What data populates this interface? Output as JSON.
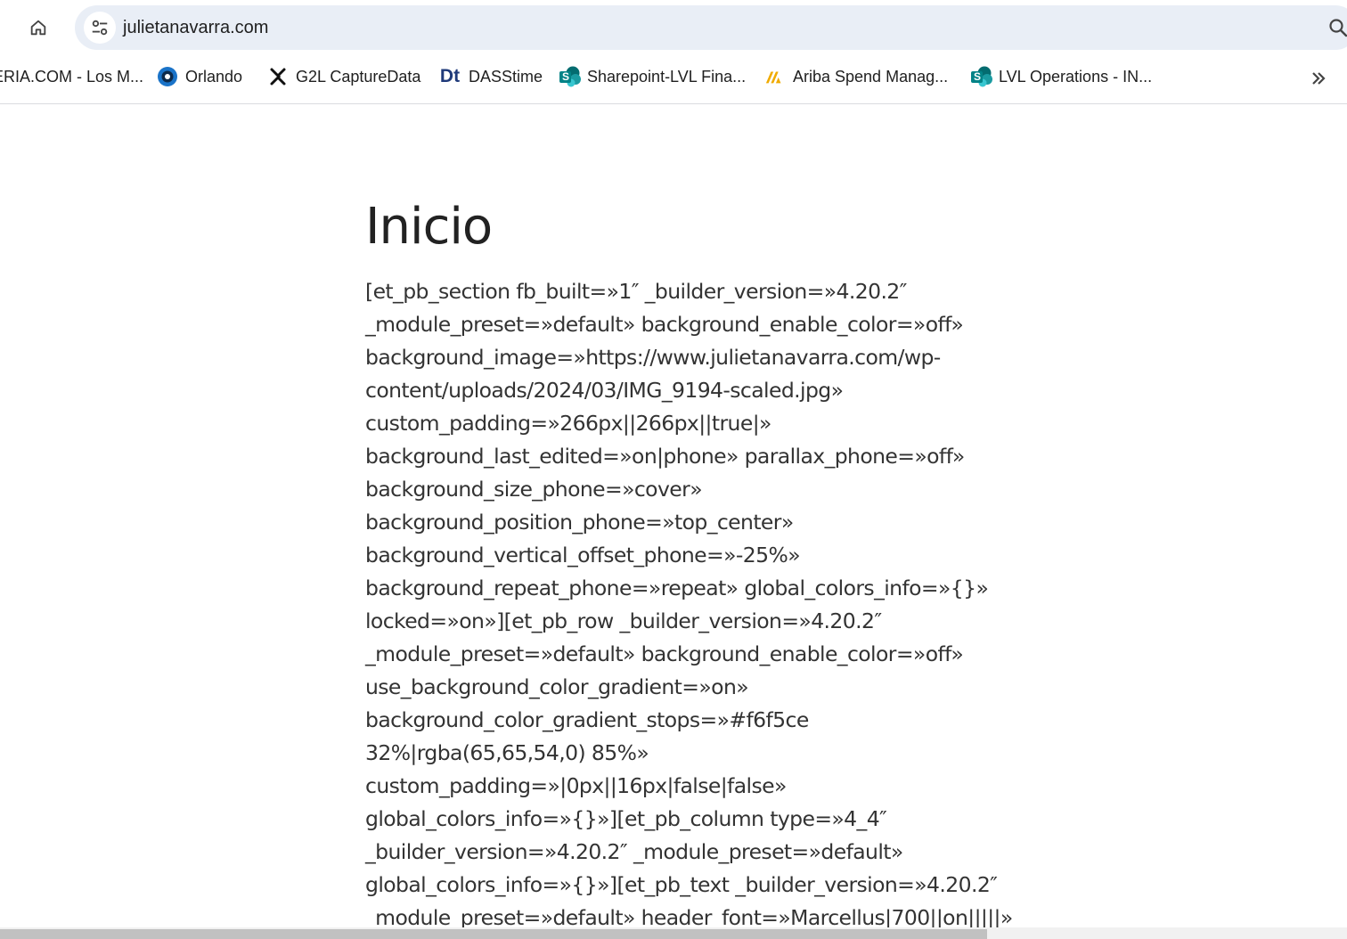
{
  "browser": {
    "url": "julietanavarra.com"
  },
  "bookmarks": [
    {
      "label": "ERIA.COM - Los M...",
      "icon": "none"
    },
    {
      "label": "Orlando",
      "icon": "circle-logo-icon"
    },
    {
      "label": "G2L CaptureData",
      "icon": "g2l-logo-icon"
    },
    {
      "label": "DASStime",
      "icon": "dt-logo-icon",
      "icon_text": "Dt"
    },
    {
      "label": "Sharepoint-LVL Fina...",
      "icon": "sharepoint-icon",
      "icon_text": "S"
    },
    {
      "label": "Ariba Spend Manag...",
      "icon": "ariba-logo-icon"
    },
    {
      "label": "LVL Operations - IN...",
      "icon": "sharepoint-icon",
      "icon_text": "S"
    }
  ],
  "page": {
    "title": "Inicio",
    "lines": [
      "[et_pb_section fb_built=»1″ _builder_version=»4.20.2″",
      "_module_preset=»default» background_enable_color=»off»",
      "background_image=»https://www.julietanavarra.com/wp-",
      "content/uploads/2024/03/IMG_9194-scaled.jpg»",
      "custom_padding=»266px||266px||true|»",
      "background_last_edited=»on|phone» parallax_phone=»off»",
      "background_size_phone=»cover»",
      "background_position_phone=»top_center»",
      "background_vertical_offset_phone=»-25%»",
      "background_repeat_phone=»repeat» global_colors_info=»{}»",
      "locked=»on»][et_pb_row _builder_version=»4.20.2″",
      "_module_preset=»default» background_enable_color=»off»",
      "use_background_color_gradient=»on»",
      "background_color_gradient_stops=»#f6f5ce",
      "32%|rgba(65,65,54,0) 85%»",
      "custom_padding=»|0px||16px|false|false»",
      "global_colors_info=»{}»][et_pb_column type=»4_4″",
      "_builder_version=»4.20.2″ _module_preset=»default»",
      "global_colors_info=»{}»][et_pb_text _builder_version=»4.20.2″",
      "_module_preset=»default» header_font=»Marcellus|700||on|||||»"
    ]
  },
  "colors": {
    "omnibox_bg": "#e9eef6",
    "sharepoint": "#038387",
    "dt_blue": "#1f3a7a",
    "ariba_yellow": "#f0ab00"
  }
}
